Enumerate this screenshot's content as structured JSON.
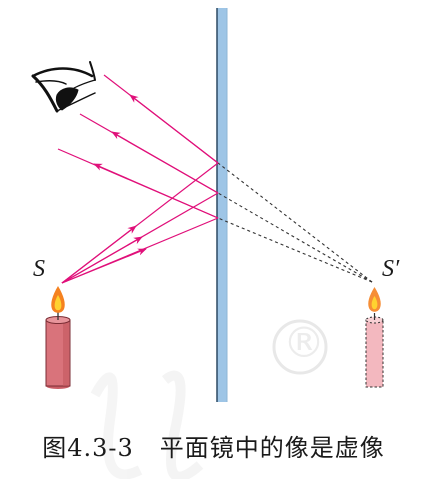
{
  "labels": {
    "source": "S",
    "image": "S′"
  },
  "caption": {
    "number": "图4.3-3",
    "text": "平面镜中的像是虚像"
  },
  "watermark": {
    "symbol": "®"
  },
  "colors": {
    "mirror_fill": "#9ec5e6",
    "mirror_edge": "#2d4a63",
    "ray": "#e0107a",
    "virtual_ray": "#333333",
    "candle": "#d9737b",
    "candle_image": "#f3b8bf",
    "flame_outer": "#f58220",
    "flame_inner": "#ffd230",
    "watermark": "#ececec"
  },
  "icons": [
    "eye-icon",
    "candle-icon",
    "flame-icon",
    "candle-image-icon"
  ]
}
